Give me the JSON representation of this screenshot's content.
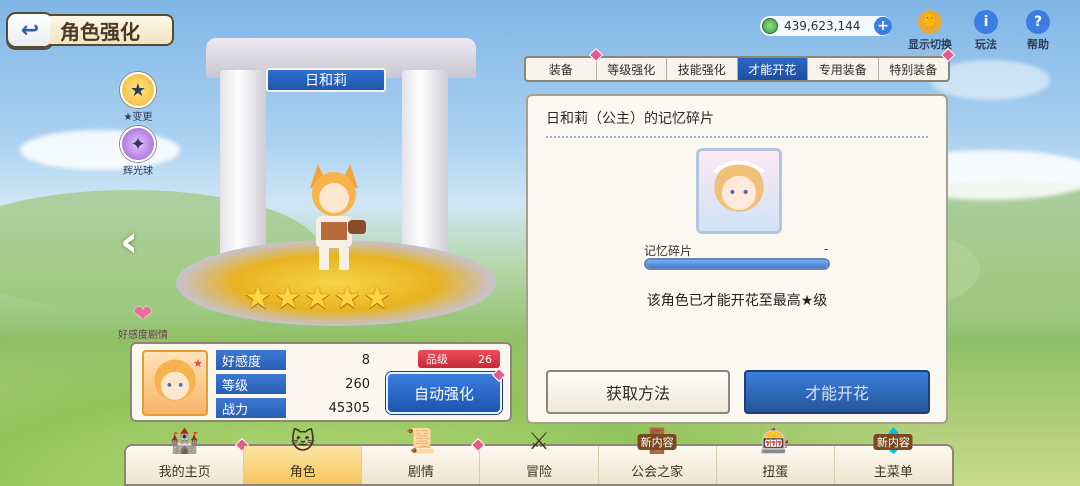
{
  "header": {
    "title": "角色强化"
  },
  "currency": {
    "amount": "439,623,144"
  },
  "top_icons": [
    {
      "label": "显示切换"
    },
    {
      "label": "玩法"
    },
    {
      "label": "帮助"
    }
  ],
  "tabs": [
    {
      "label": "装备"
    },
    {
      "label": "等级强化"
    },
    {
      "label": "技能强化"
    },
    {
      "label": "才能开花"
    },
    {
      "label": "专用装备"
    },
    {
      "label": "特别装备"
    }
  ],
  "character": {
    "name": "日和莉",
    "star_count": 5,
    "side_buttons": [
      {
        "label": "★变更"
      },
      {
        "label": "辉光球"
      }
    ],
    "affinity_label": "好感度剧情"
  },
  "stats": {
    "rows": [
      {
        "label": "好感度",
        "value": "8"
      },
      {
        "label": "等级",
        "value": "260"
      },
      {
        "label": "战力",
        "value": "45305"
      }
    ],
    "rank_label": "品级",
    "rank_value": "26",
    "auto_button": "自动强化"
  },
  "memory": {
    "title": "日和莉（公主）的记忆碎片",
    "fragment_label": "记忆碎片",
    "fragment_value": "-",
    "progress": 1.0,
    "note": "该角色已才能开花至最高★级",
    "get_button": "获取方法",
    "bloom_button": "才能开花"
  },
  "bottom_nav": [
    {
      "label": "我的主页",
      "new": ""
    },
    {
      "label": "角色",
      "new": ""
    },
    {
      "label": "剧情",
      "new": ""
    },
    {
      "label": "冒险",
      "new": ""
    },
    {
      "label": "公会之家",
      "new": "新内容"
    },
    {
      "label": "扭蛋",
      "new": ""
    },
    {
      "label": "主菜单",
      "new": "新内容"
    }
  ],
  "colors": {
    "accent_blue": "#2b67c7",
    "badge_pink": "#e35b8b",
    "star_gold": "#ffd447",
    "rank_red": "#d9394a"
  }
}
